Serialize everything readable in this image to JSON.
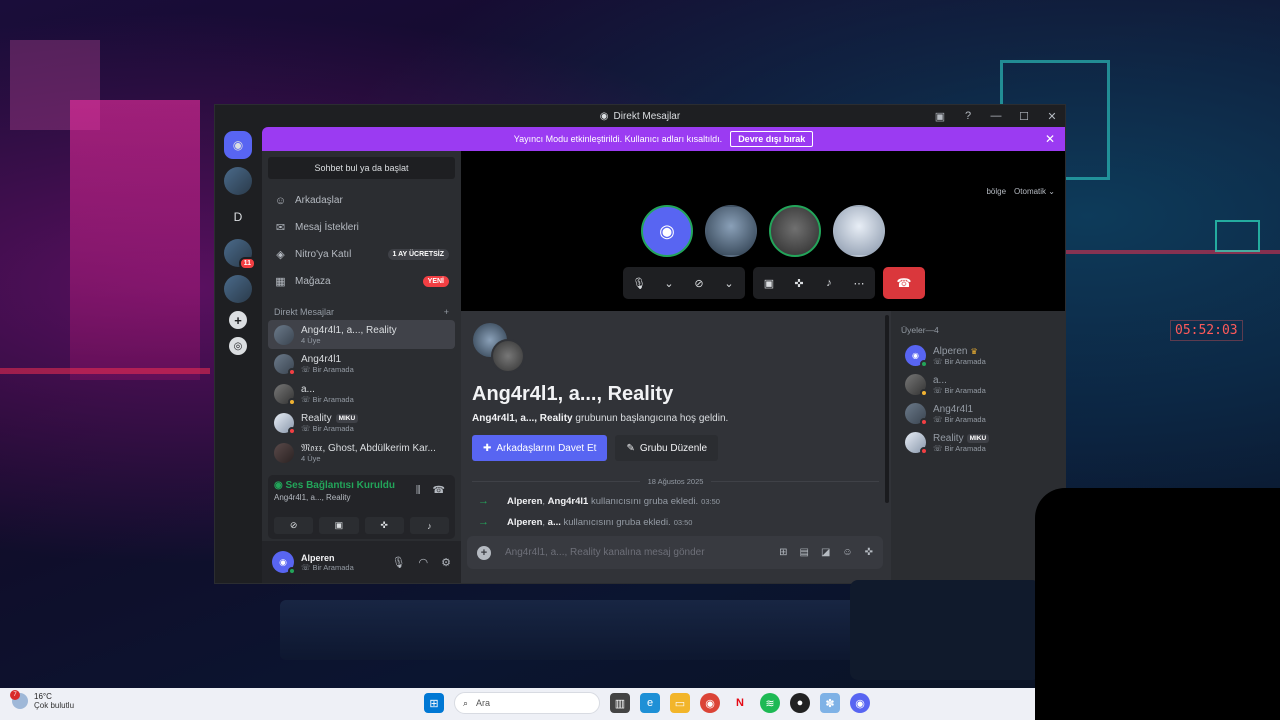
{
  "window": {
    "title": "Direkt Mesajlar"
  },
  "banner": {
    "text": "Yayıncı Modu etkinleştirildi. Kullanıcı adları kısaltıldı.",
    "button": "Devre dışı bırak"
  },
  "rail": {
    "letter_server": "D",
    "badge_count": "11"
  },
  "sidebar": {
    "search_placeholder": "Sohbet bul ya da başlat",
    "nav": [
      {
        "label": "Arkadaşlar",
        "icon": "friends-icon"
      },
      {
        "label": "Mesaj İstekleri",
        "icon": "mail-icon"
      },
      {
        "label": "Nitro'ya Katıl",
        "icon": "nitro-icon",
        "pill": "1 AY ÜCRETSİZ"
      },
      {
        "label": "Mağaza",
        "icon": "shop-icon",
        "pill": "YENİ"
      }
    ],
    "dm_header": "Direkt Mesajlar",
    "dm_add": "+",
    "dms": [
      {
        "name": "Ang4r4l1, a..., Reality",
        "sub": "4 Üye",
        "active": true
      },
      {
        "name": "Ang4r4l1",
        "sub": "Bir Aramada"
      },
      {
        "name": "a...",
        "sub": "Bir Aramada"
      },
      {
        "name": "Reality",
        "sub": "Bir Aramada",
        "tag": "MIKU"
      },
      {
        "name": "𝔐𝔬𝔵𝔵, Ghost, Abdülkerim Kar...",
        "sub": "4 Üye"
      }
    ]
  },
  "voice": {
    "status": "Ses Bağlantısı Kuruldu",
    "channel": "Ang4r4l1, a..., Reality"
  },
  "user": {
    "name": "Alperen",
    "status": "Bir Aramada"
  },
  "call": {
    "region_label": "bölge",
    "region_value": "Otomatik"
  },
  "chat": {
    "title": "Ang4r4l1, a..., Reality",
    "welcome_bold": "Ang4r4l1, a..., Reality",
    "welcome_rest": " grubunun başlangıcına hoş geldin.",
    "invite_button": "Arkadaşlarını Davet Et",
    "edit_button": "Grubu Düzenle",
    "date": "18 Ağustos 2025",
    "messages": [
      {
        "actor": "Alperen",
        "target": "Ang4r4l1",
        "text": " kullanıcısını gruba ekledi.",
        "time": "03:50"
      },
      {
        "actor": "Alperen",
        "target": "a...",
        "text": " kullanıcısını gruba ekledi.",
        "time": "03:50"
      }
    ],
    "composer_placeholder": "Ang4r4l1, a..., Reality kanalına mesaj gönder"
  },
  "members": {
    "header": "Üyeler—4",
    "list": [
      {
        "name": "Alperen",
        "sub": "Bir Aramada",
        "crown": true
      },
      {
        "name": "a...",
        "sub": "Bir Aramada"
      },
      {
        "name": "Ang4r4l1",
        "sub": "Bir Aramada"
      },
      {
        "name": "Reality",
        "sub": "Bir Aramada",
        "tag": "MIKU"
      }
    ]
  },
  "taskbar": {
    "temp": "16°C",
    "weather": "Çok bulutlu",
    "weather_badge": "7",
    "search": "Ara"
  },
  "desktop": {
    "clock": "05:52:03"
  },
  "colors": {
    "accent": "#5865f2",
    "banner": "#9b3bf2",
    "online": "#23a55a",
    "danger": "#da373c"
  }
}
